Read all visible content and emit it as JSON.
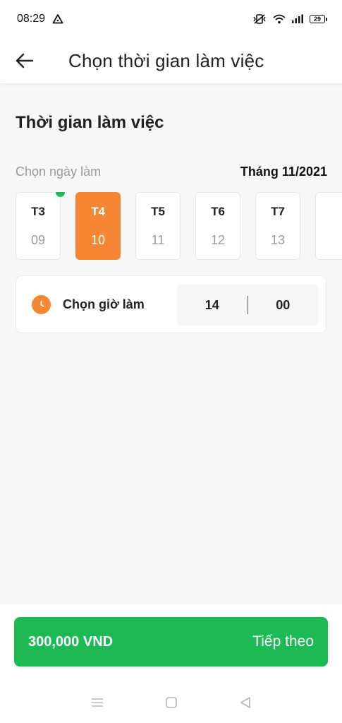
{
  "status_bar": {
    "time": "08:29",
    "battery": "29",
    "icons": [
      "alert-triangle-icon",
      "vibrate-off-icon",
      "wifi-icon",
      "signal-icon",
      "battery-icon"
    ]
  },
  "header": {
    "title": "Chọn thời gian làm việc",
    "back_icon": "arrow-left-icon"
  },
  "main": {
    "section_title": "Thời gian làm việc",
    "day_hint": "Chọn ngày làm",
    "month_label": "Tháng 11/2021",
    "days": [
      {
        "dow": "T3",
        "dom": "09",
        "selected": false,
        "indicator": true
      },
      {
        "dow": "T4",
        "dom": "10",
        "selected": true,
        "indicator": false
      },
      {
        "dow": "T5",
        "dom": "11",
        "selected": false,
        "indicator": false
      },
      {
        "dow": "T6",
        "dom": "12",
        "selected": false,
        "indicator": false
      },
      {
        "dow": "T7",
        "dom": "13",
        "selected": false,
        "indicator": false
      },
      {
        "dow": "",
        "dom": "",
        "selected": false,
        "indicator": false
      }
    ],
    "time": {
      "label": "Chọn giờ làm",
      "hour": "14",
      "minute": "00",
      "icon": "clock-icon"
    }
  },
  "footer": {
    "price": "300,000 VND",
    "next_label": "Tiếp theo"
  },
  "colors": {
    "accent_orange": "#f58634",
    "primary_green": "#1db954",
    "indicator_green": "#1db954",
    "background": "#f7f7f7"
  },
  "nav": {
    "icons": [
      "menu-icon",
      "home-square-icon",
      "back-triangle-icon"
    ]
  }
}
